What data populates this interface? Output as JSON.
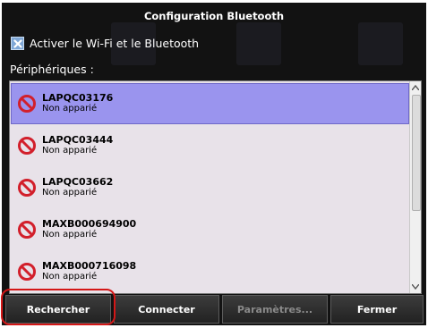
{
  "dialog": {
    "title": "Configuration Bluetooth",
    "wifi_checkbox": {
      "label": "Activer le Wi-Fi et le Bluetooth",
      "checked": true
    },
    "devices_label": "Périphériques :"
  },
  "devices": [
    {
      "name": "LAPQC03176",
      "status": "Non apparié",
      "selected": true
    },
    {
      "name": "LAPQC03444",
      "status": "Non apparié",
      "selected": false
    },
    {
      "name": "LAPQC03662",
      "status": "Non apparié",
      "selected": false
    },
    {
      "name": "MAXB000694900",
      "status": "Non apparié",
      "selected": false
    },
    {
      "name": "MAXB000716098",
      "status": "Non apparié",
      "selected": false
    }
  ],
  "buttons": {
    "search": "Rechercher",
    "connect": "Connecter",
    "settings": "Paramètres...",
    "close": "Fermer"
  },
  "colors": {
    "selection": "#9a94ee",
    "list_background": "#e8e2e9",
    "no_icon": "#d21f2b",
    "highlight_ring": "#d41717"
  },
  "icons": {
    "device_status": "no-entry-icon",
    "checkbox_mark": "x-mark-icon"
  }
}
